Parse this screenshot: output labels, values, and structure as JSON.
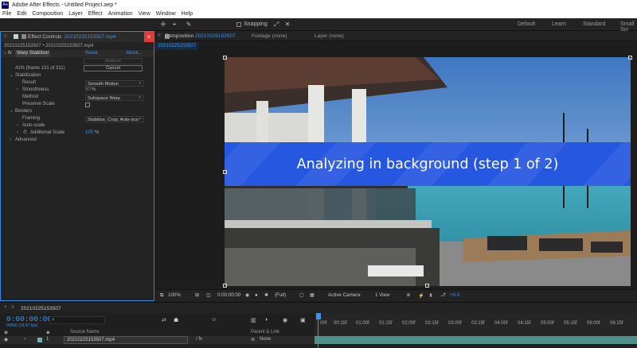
{
  "window": {
    "app_logo": "Ae",
    "title": "Adobe After Effects - Untitled Project.aep *"
  },
  "menu": [
    "File",
    "Edit",
    "Composition",
    "Layer",
    "Effect",
    "Animation",
    "View",
    "Window",
    "Help"
  ],
  "toolbar": {
    "snapping_label": "Snapping",
    "workspaces": [
      "Default",
      "Learn",
      "Standard",
      "Small Scr"
    ]
  },
  "effect_controls": {
    "tab_label": "Effect Controls",
    "tab_source": "20210225153507.mp4",
    "breadcrumb": "20210225153507 • 20210225153507.mp4",
    "effect_name": "Warp Stabilizer",
    "reset": "Reset",
    "about": "About...",
    "analyze_button": "Analyze",
    "progress_text": "41% (frame 131 of 311)",
    "progress_fraction": 0.42,
    "cancel_button": "Cancel",
    "stabilization_label": "Stabilization",
    "result_label": "Result",
    "result_value": "Smooth Motion",
    "smoothness_label": "Smoothness",
    "smoothness_value": "50",
    "smoothness_unit": "%",
    "method_label": "Method",
    "method_value": "Subspace Warp",
    "preserve_scale_label": "Preserve Scale",
    "borders_label": "Borders",
    "framing_label": "Framing",
    "framing_value": "Stabilize, Crop, Auto-sca",
    "auto_scale_label": "Auto-scale",
    "additional_scale_label": "Additional Scale",
    "additional_scale_value": "100",
    "additional_scale_unit": "%",
    "advanced_label": "Advanced"
  },
  "composition": {
    "tab_label": "Composition",
    "tab_name": "20210225153507",
    "footage_tab": "Footage (none)",
    "layer_tab": "Layer (none)",
    "sub_tab_name": "20210225153507",
    "status_banner": "Analyzing in background (step 1 of 2)"
  },
  "viewer_controls": {
    "zoom": "100%",
    "timecode": "0:00:00:00",
    "resolution": "(Full)",
    "camera": "Active Camera",
    "views": "1 View",
    "exposure": "+0.0"
  },
  "timeline": {
    "tab_label": "20210225153507",
    "current_time": "0:00:00:00",
    "fps_text": "00000 (29.97 fps)",
    "search_placeholder": "",
    "col_source_name": "Source Name",
    "col_parent": "Parent & Link",
    "layer_number": "1",
    "layer_name": "20210225153507.mp4",
    "layer_parent": "None",
    "ruler_labels": [
      "00f",
      "00:15f",
      "01:00f",
      "01:15f",
      "02:00f",
      "02:15f",
      "03:00f",
      "03:15f",
      "04:00f",
      "04:15f",
      "05:00f",
      "05:15f",
      "06:00f",
      "06:15f"
    ]
  },
  "colors": {
    "accent": "#3d92f0",
    "banner": "#2557e0",
    "close_button": "#e03b3b",
    "work_area": "#4d8f89"
  }
}
